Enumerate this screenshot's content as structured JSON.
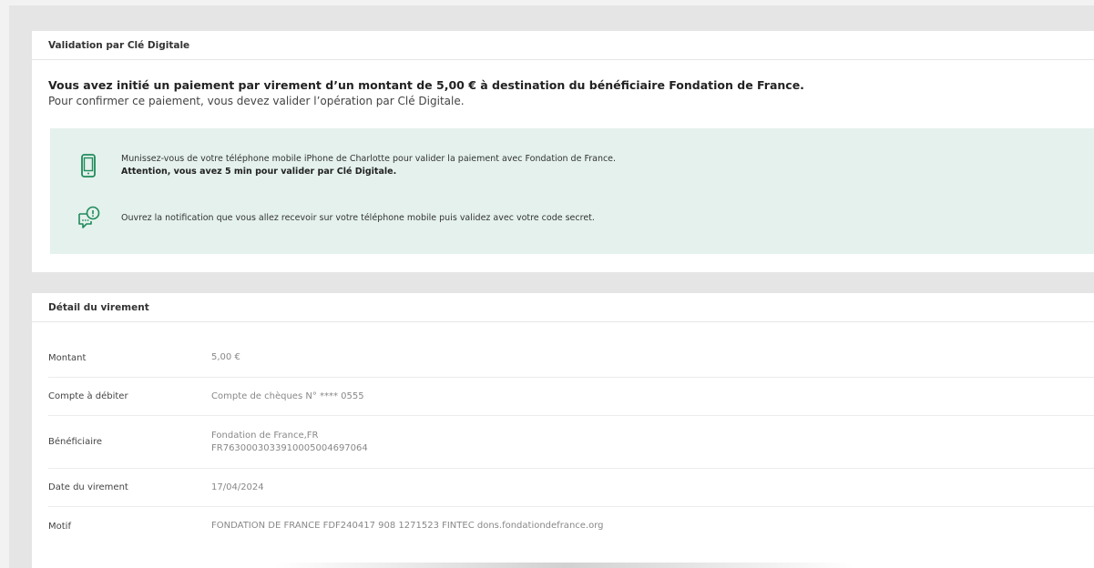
{
  "colors": {
    "accent_green": "#1f8a5b",
    "info_box_bg": "#e4f1ec",
    "page_bg": "#e5e5e5"
  },
  "validation": {
    "header": "Validation par Clé Digitale",
    "intro_bold": "Vous avez initié un paiement par virement d’un montant de 5,00 € à destination du bénéficiaire Fondation de France.",
    "intro_text": "Pour confirmer ce paiement, vous devez valider l’opération par Clé Digitale.",
    "info": {
      "phone_icon": "smartphone-icon",
      "phone_line1": "Munissez-vous de votre téléphone mobile iPhone de Charlotte pour valider la paiement avec Fondation de France.",
      "phone_line2": "Attention, vous avez 5 min pour valider par Clé Digitale.",
      "notification_icon": "notification-bubble-icon",
      "notification_text": "Ouvrez la notification que vous allez recevoir sur votre téléphone mobile puis validez avec votre code secret."
    }
  },
  "detail": {
    "header": "Détail du virement",
    "rows": [
      {
        "label": "Montant",
        "value": "5,00 €"
      },
      {
        "label": "Compte à débiter",
        "value": "Compte de chèques N° **** 0555"
      },
      {
        "label": "Bénéficiaire",
        "value": "Fondation de France,FR",
        "value2": "FR7630003033910005004697064"
      },
      {
        "label": "Date du virement",
        "value": "17/04/2024"
      },
      {
        "label": "Motif",
        "value": "FONDATION DE FRANCE FDF240417 908 1271523 FINTEC dons.fondationdefrance.org"
      }
    ]
  }
}
